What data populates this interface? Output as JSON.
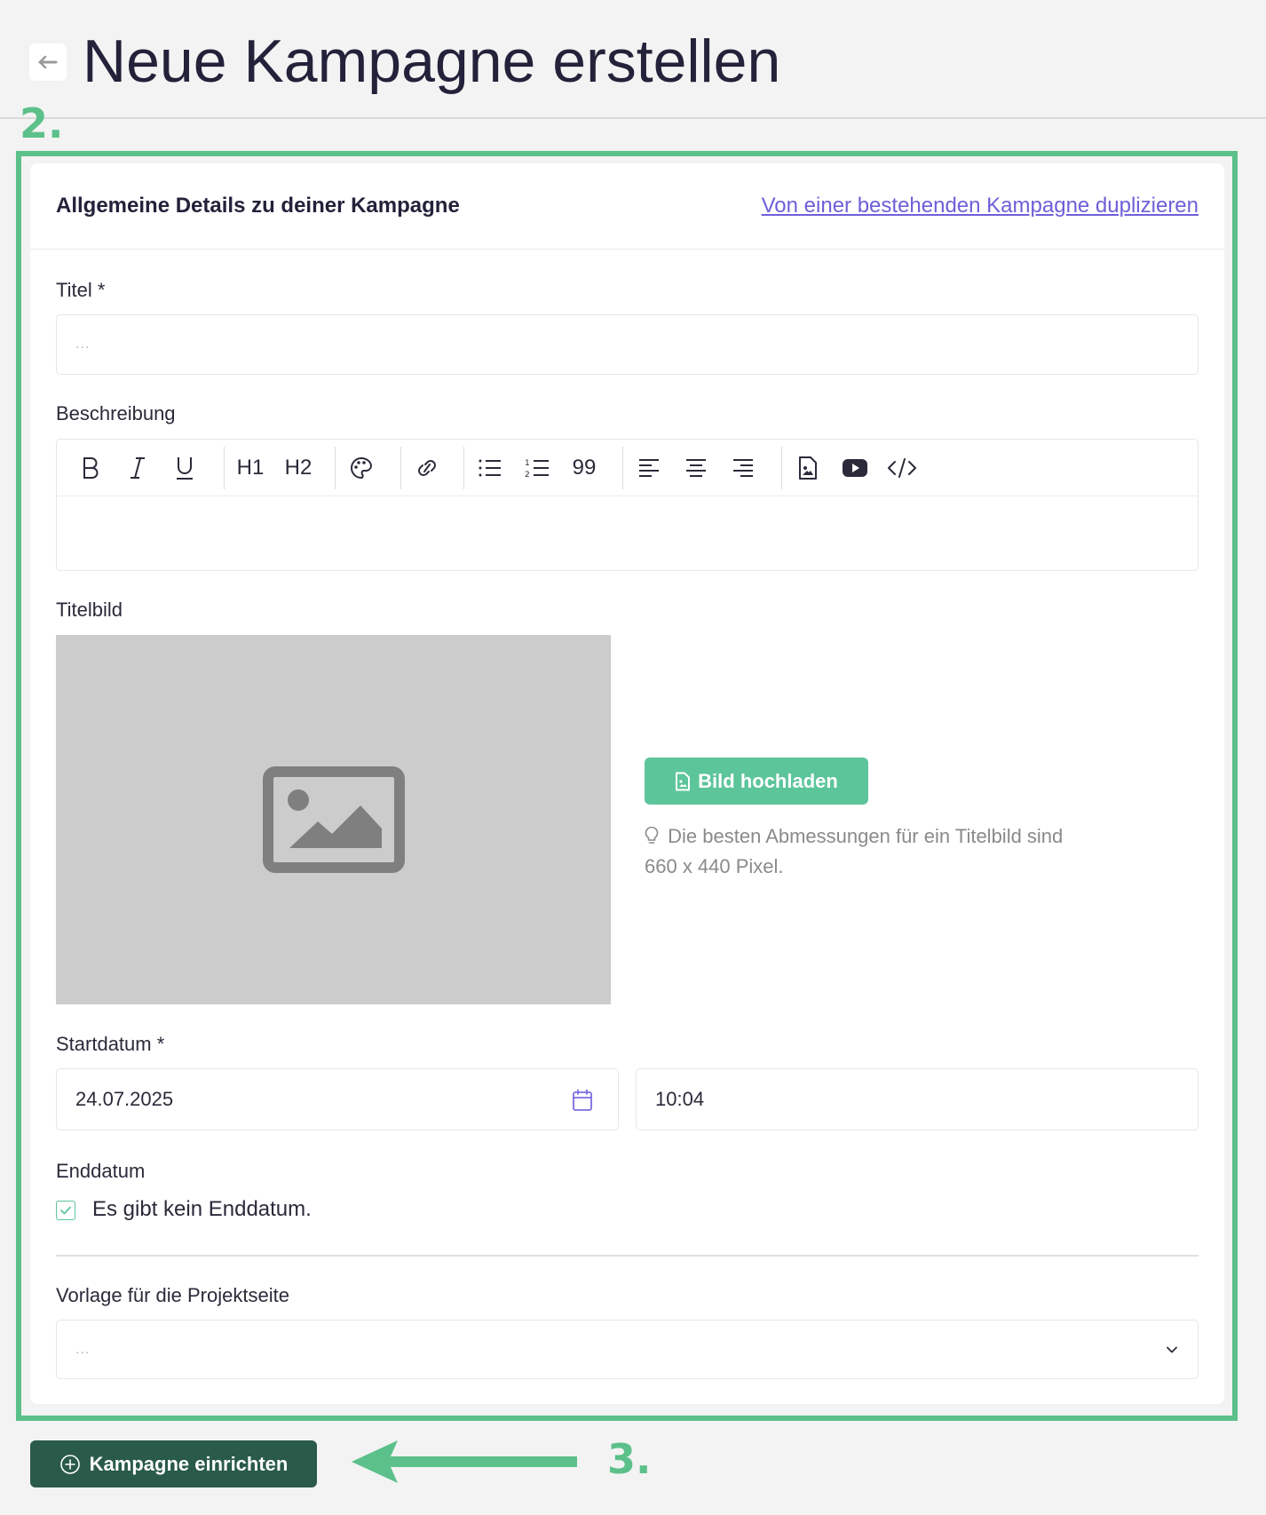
{
  "header": {
    "title": "Neue Kampagne erstellen",
    "back_icon": "arrow-left-icon"
  },
  "annotations": {
    "step2": "2.",
    "step3": "3.",
    "color": "#5cc08a"
  },
  "card": {
    "title": "Allgemeine Details zu deiner Kampagne",
    "duplicate_link": "Von einer bestehenden Kampagne duplizieren"
  },
  "form": {
    "title_label": "Titel *",
    "title_placeholder": "...",
    "description_label": "Beschreibung",
    "toolbar": {
      "h1": "H1",
      "h2": "H2",
      "quote": "99",
      "icons": [
        "bold-icon",
        "italic-icon",
        "underline-icon",
        "palette-icon",
        "link-icon",
        "bullet-list-icon",
        "numbered-list-icon",
        "quote-icon",
        "align-left-icon",
        "align-center-icon",
        "align-right-icon",
        "image-file-icon",
        "youtube-icon",
        "code-icon"
      ]
    },
    "cover_label": "Titelbild",
    "upload_button": "Bild hochladen",
    "hint_line1": "Die besten Abmessungen für ein Titelbild sind",
    "hint_line2": "660 x 440 Pixel.",
    "start_label": "Startdatum *",
    "start_date": "24.07.2025",
    "start_time": "10:04",
    "end_label": "Enddatum",
    "no_end_date": "Es gibt kein Enddatum.",
    "no_end_date_checked": true,
    "template_label": "Vorlage für die Projektseite",
    "template_placeholder": "..."
  },
  "actions": {
    "submit": "Kampagne einrichten"
  },
  "colors": {
    "accent_green": "#5cc59a",
    "dark_green": "#2a5a4a",
    "link_purple": "#6d5fd8"
  }
}
